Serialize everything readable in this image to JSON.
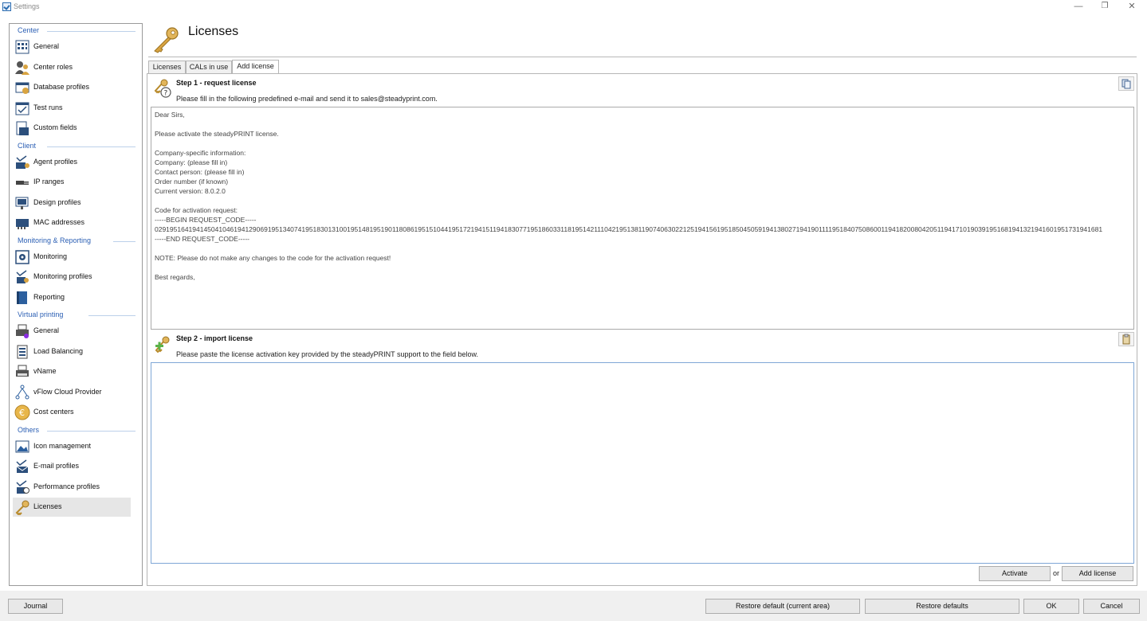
{
  "window": {
    "title": "Settings",
    "minimize": "—",
    "restore": "❐",
    "close": "✕"
  },
  "sidebar": {
    "sections": [
      {
        "title": "Center",
        "items": [
          {
            "label": "General",
            "icon": "grid-icon"
          },
          {
            "label": "Center roles",
            "icon": "users-icon"
          },
          {
            "label": "Database profiles",
            "icon": "database-icon"
          },
          {
            "label": "Test runs",
            "icon": "calendar-check-icon"
          },
          {
            "label": "Custom fields",
            "icon": "form-icon"
          }
        ]
      },
      {
        "title": "Client",
        "items": [
          {
            "label": "Agent profiles",
            "icon": "agent-icon"
          },
          {
            "label": "IP ranges",
            "icon": "plug-icon"
          },
          {
            "label": "Design profiles",
            "icon": "monitor-icon"
          },
          {
            "label": "MAC addresses",
            "icon": "network-card-icon"
          }
        ]
      },
      {
        "title": "Monitoring & Reporting",
        "items": [
          {
            "label": "Monitoring",
            "icon": "monitoring-icon"
          },
          {
            "label": "Monitoring profiles",
            "icon": "monitoring-profiles-icon"
          },
          {
            "label": "Reporting",
            "icon": "book-icon"
          }
        ]
      },
      {
        "title": "Virtual printing",
        "items": [
          {
            "label": "General",
            "icon": "printer-icon"
          },
          {
            "label": "Load Balancing",
            "icon": "load-balancing-icon"
          },
          {
            "label": "vName",
            "icon": "printer-name-icon"
          },
          {
            "label": "vFlow Cloud Provider",
            "icon": "flow-icon"
          },
          {
            "label": "Cost centers",
            "icon": "euro-coin-icon"
          }
        ]
      },
      {
        "title": "Others",
        "items": [
          {
            "label": "Icon management",
            "icon": "image-icon"
          },
          {
            "label": "E-mail profiles",
            "icon": "email-icon"
          },
          {
            "label": "Performance profiles",
            "icon": "performance-icon"
          },
          {
            "label": "Licenses",
            "icon": "key-icon",
            "selected": true
          }
        ]
      }
    ]
  },
  "header": {
    "title": "Licenses",
    "icon": "key-icon"
  },
  "tabs": [
    {
      "label": "Licenses",
      "active": false
    },
    {
      "label": "CALs in use",
      "active": false
    },
    {
      "label": "Add license",
      "active": true
    }
  ],
  "step1": {
    "title": "Step 1 - request license",
    "description": "Please fill in the following predefined e-mail and send it to sales@steadyprint.com.",
    "copy_icon": "copy-icon",
    "email_lines": [
      "Dear Sirs,",
      "",
      "Please activate the steadyPRINT license.",
      "",
      "Company-specific information:",
      "Company: (please fill in)",
      "Contact person: (please fill in)",
      "Order number (if known)",
      "Current version: 8.0.2.0",
      "",
      "Code for activation request:",
      "-----BEGIN REQUEST_CODE-----",
      "0291951641941450410461941290691951340741951830131001951481951901180861951510441951721941511941830771951860331181951421110421951381190740630221251941561951850450591941380271941901111951840750860011941820080420511941710190391951681941321941601951731941681",
      "-----END REQUEST_CODE-----",
      "",
      "NOTE: Please do not make any changes to the code for the activation request!",
      "",
      "Best regards,"
    ]
  },
  "step2": {
    "title": "Step 2 - import license",
    "description": "Please paste the license activation key provided by the steadyPRINT support to the field below.",
    "paste_icon": "paste-icon",
    "paste_value": ""
  },
  "actions": {
    "activate": "Activate",
    "or": "or",
    "add_license": "Add license"
  },
  "footer": {
    "journal": "Journal",
    "restore_current": "Restore default (current area)",
    "restore_defaults": "Restore defaults",
    "ok": "OK",
    "cancel": "Cancel"
  },
  "colors": {
    "section_title": "#2b5fb4",
    "selected_item": "#e6e6e6",
    "key_gold": "#d9a441",
    "paste_border": "#7fa7d6"
  }
}
